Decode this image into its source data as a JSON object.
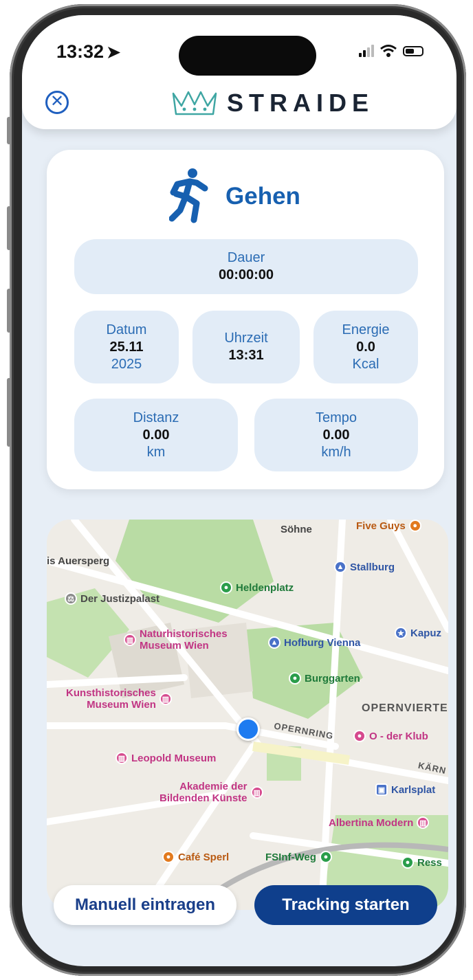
{
  "status_bar": {
    "time": "13:32",
    "location_arrow": "location-arrow-icon"
  },
  "header": {
    "brand": "STRAIDE",
    "close_icon": "close-circle-icon",
    "logo_icon": "crown-logo-icon"
  },
  "activity": {
    "name": "Gehen",
    "icon": "running-person-icon"
  },
  "stats": {
    "duration": {
      "label": "Dauer",
      "value": "00:00:00"
    },
    "date": {
      "label": "Datum",
      "value": "25.11",
      "sub": "2025"
    },
    "time": {
      "label": "Uhrzeit",
      "value": "13:31"
    },
    "energy": {
      "label": "Energie",
      "value": "0.0",
      "unit": "Kcal"
    },
    "distance": {
      "label": "Distanz",
      "value": "0.00",
      "unit": "km"
    },
    "pace": {
      "label": "Tempo",
      "value": "0.00",
      "unit": "km/h"
    }
  },
  "map": {
    "labels": {
      "soehne": "Söhne",
      "five_guys": "Five Guys",
      "auersperg": "is Auersperg",
      "stallburg": "Stallburg",
      "justizpalast": "Der Justizpalast",
      "heldenplatz": "Heldenplatz",
      "nhm_line1": "Naturhistorisches",
      "nhm_line2": "Museum Wien",
      "hofburg": "Hofburg Vienna",
      "kapuz": "Kapuz",
      "burggarten": "Burggarten",
      "khm_line1": "Kunsthistorisches",
      "khm_line2": "Museum Wien",
      "opernviertel": "OPERNVIERTE",
      "opernring": "OPERNRING",
      "oklub": "O - der Klub",
      "leopold": "Leopold Museum",
      "kaern": "KÄRN",
      "akademie_line1": "Akademie der",
      "akademie_line2": "Bildenden Künste",
      "karlsplatz": "Karlsplat",
      "albertina": "Albertina Modern",
      "cafe_sperl": "Café Sperl",
      "fsinf": "FSInf-Weg",
      "ress": "Ress"
    }
  },
  "actions": {
    "manual": "Manuell eintragen",
    "track": "Tracking starten"
  },
  "colors": {
    "accent": "#1760b0",
    "button_primary": "#0f3f8c",
    "pill_bg": "#e2ecf7"
  }
}
